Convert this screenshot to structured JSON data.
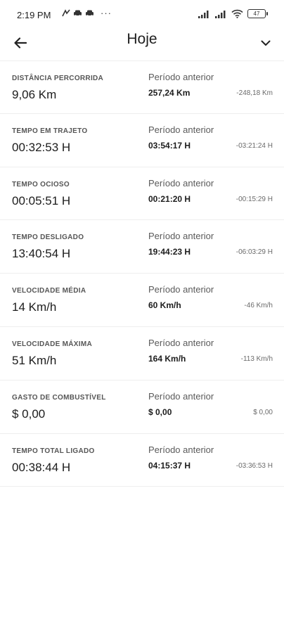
{
  "status_bar": {
    "time": "2:19 PM",
    "more": "···",
    "battery": "47"
  },
  "header": {
    "title": "Hoje"
  },
  "metrics": [
    {
      "label": "DISTÂNCIA PERCORRIDA",
      "value": "9,06 Km",
      "prev_label": "Período anterior",
      "prev_value": "257,24 Km",
      "diff": "-248,18 Km"
    },
    {
      "label": "TEMPO EM TRAJETO",
      "value": "00:32:53 H",
      "prev_label": "Período anterior",
      "prev_value": "03:54:17 H",
      "diff": "-03:21:24 H"
    },
    {
      "label": "TEMPO OCIOSO",
      "value": "00:05:51 H",
      "prev_label": "Período anterior",
      "prev_value": "00:21:20 H",
      "diff": "-00:15:29 H"
    },
    {
      "label": "TEMPO DESLIGADO",
      "value": "13:40:54 H",
      "prev_label": "Período anterior",
      "prev_value": "19:44:23 H",
      "diff": "-06:03:29 H"
    },
    {
      "label": "VELOCIDADE MÉDIA",
      "value": "14 Km/h",
      "prev_label": "Período anterior",
      "prev_value": "60 Km/h",
      "diff": "-46 Km/h"
    },
    {
      "label": "VELOCIDADE MÁXIMA",
      "value": "51 Km/h",
      "prev_label": "Período anterior",
      "prev_value": "164 Km/h",
      "diff": "-113 Km/h"
    },
    {
      "label": "GASTO DE COMBUSTÍVEL",
      "value": "$ 0,00",
      "prev_label": "Período anterior",
      "prev_value": "$ 0,00",
      "diff": "$ 0,00"
    },
    {
      "label": "TEMPO TOTAL LIGADO",
      "value": "00:38:44 H",
      "prev_label": "Período anterior",
      "prev_value": "04:15:37 H",
      "diff": "-03:36:53 H"
    }
  ]
}
